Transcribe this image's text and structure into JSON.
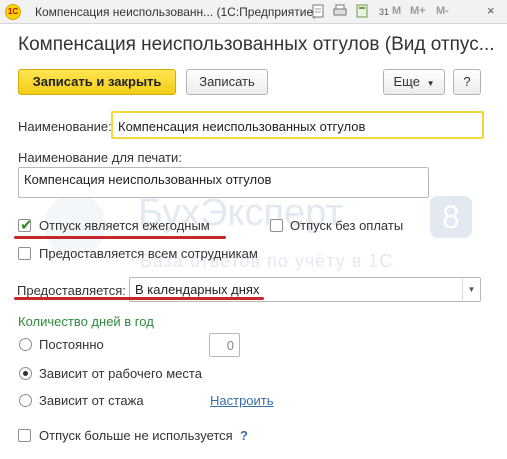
{
  "window": {
    "title": "Компенсация неиспользованн... (1С:Предприятие)",
    "logo_text": "1С",
    "toolbar_icons": [
      "document-icon",
      "print-icon",
      "calculator-icon",
      "calendar-icon"
    ],
    "calendar_day": "31",
    "memory_buttons": [
      "M",
      "M+",
      "M-"
    ],
    "close_glyph": "×"
  },
  "form": {
    "title": "Компенсация неиспользованных отгулов (Вид отпус..."
  },
  "toolbar": {
    "save_close_label": "Записать и закрыть",
    "save_label": "Записать",
    "more_label": "Еще",
    "help_label": "?"
  },
  "fields": {
    "name_label": "Наименование:",
    "name_value": "Компенсация неиспользованных отгулов",
    "print_name_label": "Наименование для печати:",
    "print_name_value": "Компенсация неиспользованных отгулов"
  },
  "checkboxes": {
    "annual": {
      "label": "Отпуск является ежегодным",
      "checked": true
    },
    "unpaid": {
      "label": "Отпуск без оплаты",
      "checked": false
    },
    "all_employees": {
      "label": "Предоставляется всем сотрудникам",
      "checked": false
    },
    "not_used": {
      "label": "Отпуск больше не используется",
      "checked": false,
      "help": "?"
    }
  },
  "provided": {
    "label": "Предоставляется:",
    "value": "В календарных днях"
  },
  "days": {
    "section_title": "Количество дней в год",
    "options": [
      {
        "label": "Постоянно",
        "selected": false
      },
      {
        "label": "Зависит от рабочего места",
        "selected": true
      },
      {
        "label": "Зависит от стажа",
        "selected": false
      }
    ],
    "constant_value": "0",
    "configure_link": "Настроить"
  },
  "watermark": {
    "brand": "БухЭксперт",
    "number": "8",
    "tagline": "База ответов по учёту в 1С"
  },
  "colors": {
    "primary_button": "#f2cd17",
    "checkmark": "#2e8b2e",
    "section_title": "#2f8a3d",
    "link": "#3a6ea5",
    "annotation_underline": "#c6272d",
    "focus_border": "#f5d63c"
  }
}
